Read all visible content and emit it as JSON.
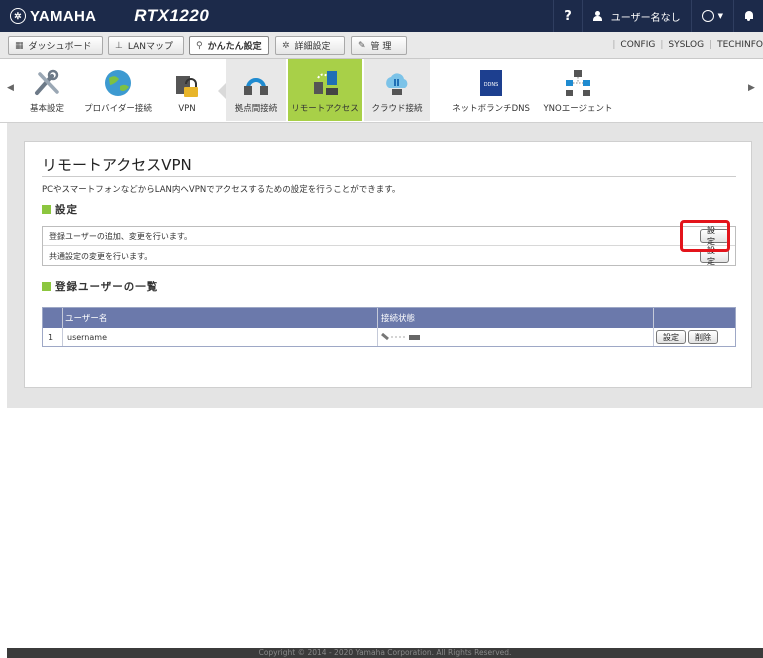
{
  "header": {
    "brand": "YAMAHA",
    "model": "RTX1220",
    "help": "?",
    "user": "ユーザー名なし"
  },
  "menu": {
    "items": [
      {
        "label": "ダッシュボード",
        "icon": "dashboard-icon"
      },
      {
        "label": "LANマップ",
        "icon": "lanmap-icon"
      },
      {
        "label": "かんたん設定",
        "icon": "wizard-icon",
        "active": true
      },
      {
        "label": "詳細設定",
        "icon": "gear-icon"
      },
      {
        "label": "管 理",
        "icon": "wrench-icon"
      }
    ],
    "links": [
      "CONFIG",
      "SYSLOG",
      "TECHINFO"
    ]
  },
  "toolbar": {
    "items": [
      {
        "label": "基本設定"
      },
      {
        "label": "プロバイダー接続"
      },
      {
        "label": "VPN"
      },
      {
        "label": "拠点間接続"
      },
      {
        "label": "リモートアクセス",
        "selected": true
      },
      {
        "label": "クラウド接続"
      },
      {
        "label": "ネットボランチDNS"
      },
      {
        "label": "YNOエージェント"
      }
    ]
  },
  "page": {
    "title": "リモートアクセスVPN",
    "description": "PCやスマートフォンなどからLAN内へVPNでアクセスするための設定を行うことができます。",
    "settings_heading": "設定",
    "settings": [
      {
        "text": "登録ユーザーの追加、変更を行います。",
        "button": "設定"
      },
      {
        "text": "共通設定の変更を行います。",
        "button": "設定"
      }
    ],
    "users_heading": "登録ユーザーの一覧",
    "table": {
      "columns": [
        "",
        "ユーザー名",
        "接続状態",
        ""
      ],
      "rows": [
        {
          "index": "1",
          "username": "username",
          "edit": "設定",
          "delete": "削除"
        }
      ]
    }
  },
  "footer": {
    "copyright": "Copyright © 2014 - 2020 Yamaha Corporation. All Rights Reserved."
  }
}
